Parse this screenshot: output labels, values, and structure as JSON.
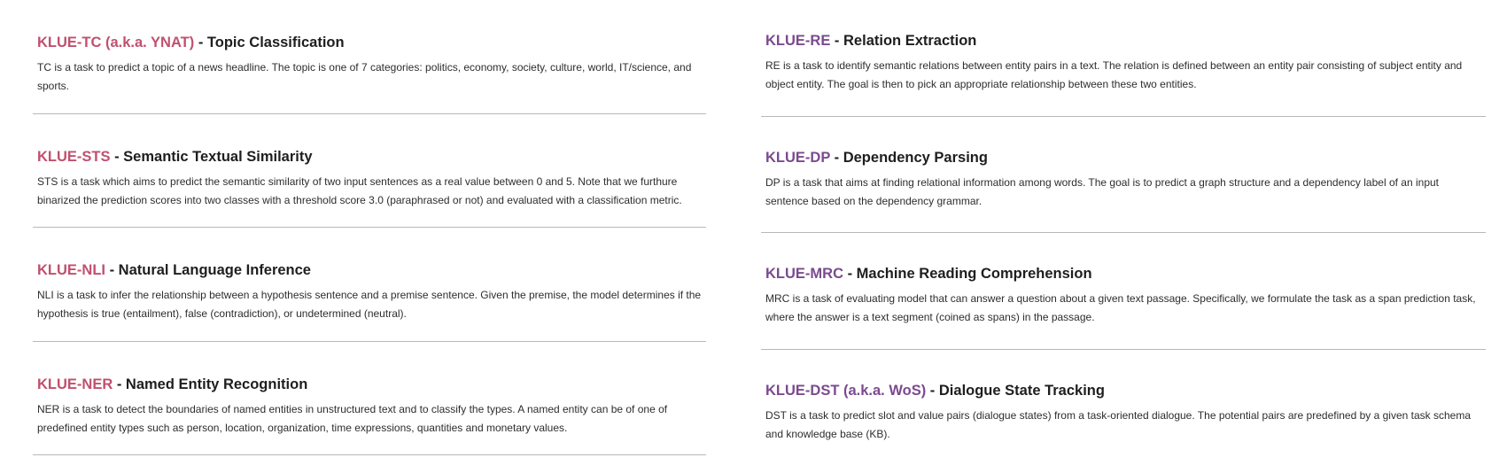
{
  "colors": {
    "left_accent": "#c0506e",
    "right_accent": "#7b4a8f",
    "divider": "#b8b8b8",
    "text": "#222222"
  },
  "left_tasks": [
    {
      "code": "KLUE-TC (a.k.a. YNAT)",
      "separator": " - ",
      "name": "Topic Classification",
      "description": "TC is a task to predict a topic of a news headline. The topic is one of 7 categories: politics, economy, society, culture, world, IT/science, and sports."
    },
    {
      "code": "KLUE-STS",
      "separator": " - ",
      "name": "Semantic Textual Similarity",
      "description": "STS is a task which aims to predict the semantic similarity of two input sentences as a real value between 0 and 5. Note that we furthure binarized the prediction scores into two classes with a threshold score 3.0 (paraphrased or not) and evaluated with a classification metric."
    },
    {
      "code": "KLUE-NLI",
      "separator": " - ",
      "name": "Natural Language Inference",
      "description": "NLI is a task to infer the relationship between a hypothesis sentence and a premise sentence. Given the premise, the model determines if the hypothesis is true (entailment), false (contradiction), or undetermined (neutral)."
    },
    {
      "code": "KLUE-NER",
      "separator": " - ",
      "name": "Named Entity Recognition",
      "description": "NER is a task to detect the boundaries of named entities in unstructured text and to classify the types. A named entity can be of one of predefined entity types such as person, location, organization, time expressions, quantities and monetary values."
    }
  ],
  "right_tasks": [
    {
      "code": "KLUE-RE",
      "separator": " - ",
      "name": "Relation Extraction",
      "description": "RE is a task to identify semantic relations between entity pairs in a text. The relation is defined between an entity pair consisting of subject entity and object entity. The goal is then to pick an appropriate relationship between these two entities."
    },
    {
      "code": "KLUE-DP",
      "separator": " - ",
      "name": "Dependency Parsing",
      "description": "DP is a task that aims at finding relational information among words. The goal is to predict a graph structure and a dependency label of an input sentence based on the dependency grammar."
    },
    {
      "code": "KLUE-MRC",
      "separator": " - ",
      "name": "Machine Reading Comprehension",
      "description": "MRC is a task of evaluating model that can answer a question about a given text passage. Specifically, we formulate the task as a span prediction task, where the answer is a text segment (coined as spans) in the passage."
    },
    {
      "code": "KLUE-DST (a.k.a. WoS)",
      "separator": " - ",
      "name": "Dialogue State Tracking",
      "description": "DST is a task to predict slot and value pairs (dialogue states) from a task-oriented dialogue. The potential pairs are predefined by a given task schema and knowledge base (KB)."
    }
  ]
}
